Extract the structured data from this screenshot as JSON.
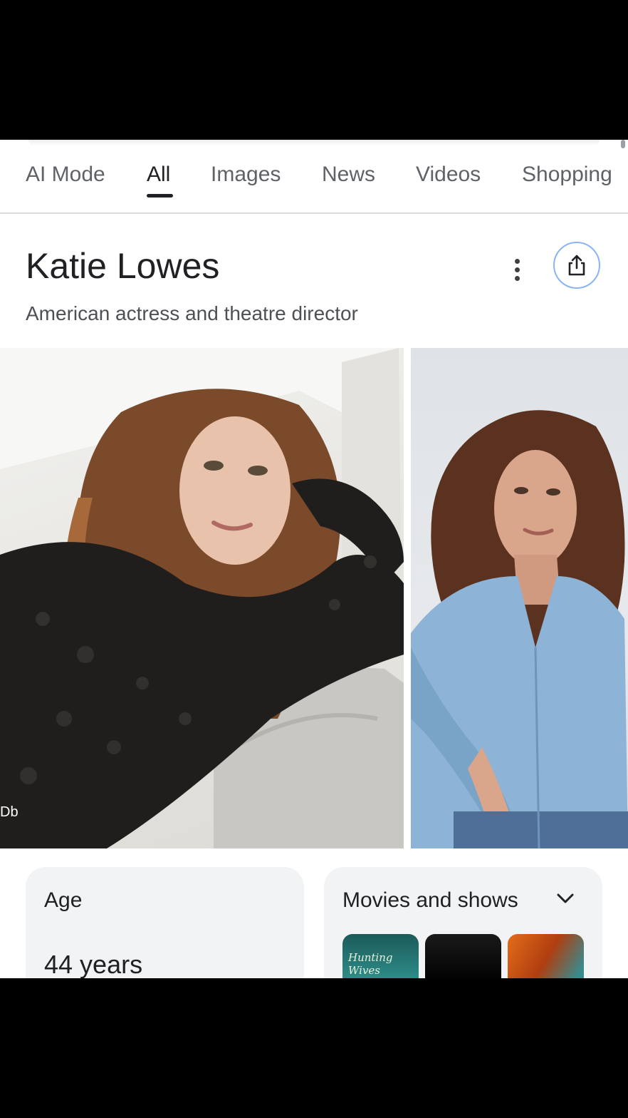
{
  "tabs": [
    {
      "label": "AI Mode"
    },
    {
      "label": "All"
    },
    {
      "label": "Images"
    },
    {
      "label": "News"
    },
    {
      "label": "Videos"
    },
    {
      "label": "Shopping"
    }
  ],
  "active_tab": "All",
  "entity": {
    "name": "Katie Lowes",
    "description": "American actress and theatre director"
  },
  "photos": {
    "credit": "Db"
  },
  "cards": {
    "age": {
      "label": "Age",
      "value": "44 years"
    },
    "movies": {
      "label": "Movies and shows"
    }
  },
  "thumbnails": {
    "first_text": "Hunting Wives"
  },
  "icons": {
    "more": "more-vert-icon",
    "share": "share-icon",
    "expand": "chevron-down-icon"
  },
  "colors": {
    "accent_ring": "#8ab4f8",
    "text_primary": "#202124",
    "text_secondary": "#5f6368"
  }
}
